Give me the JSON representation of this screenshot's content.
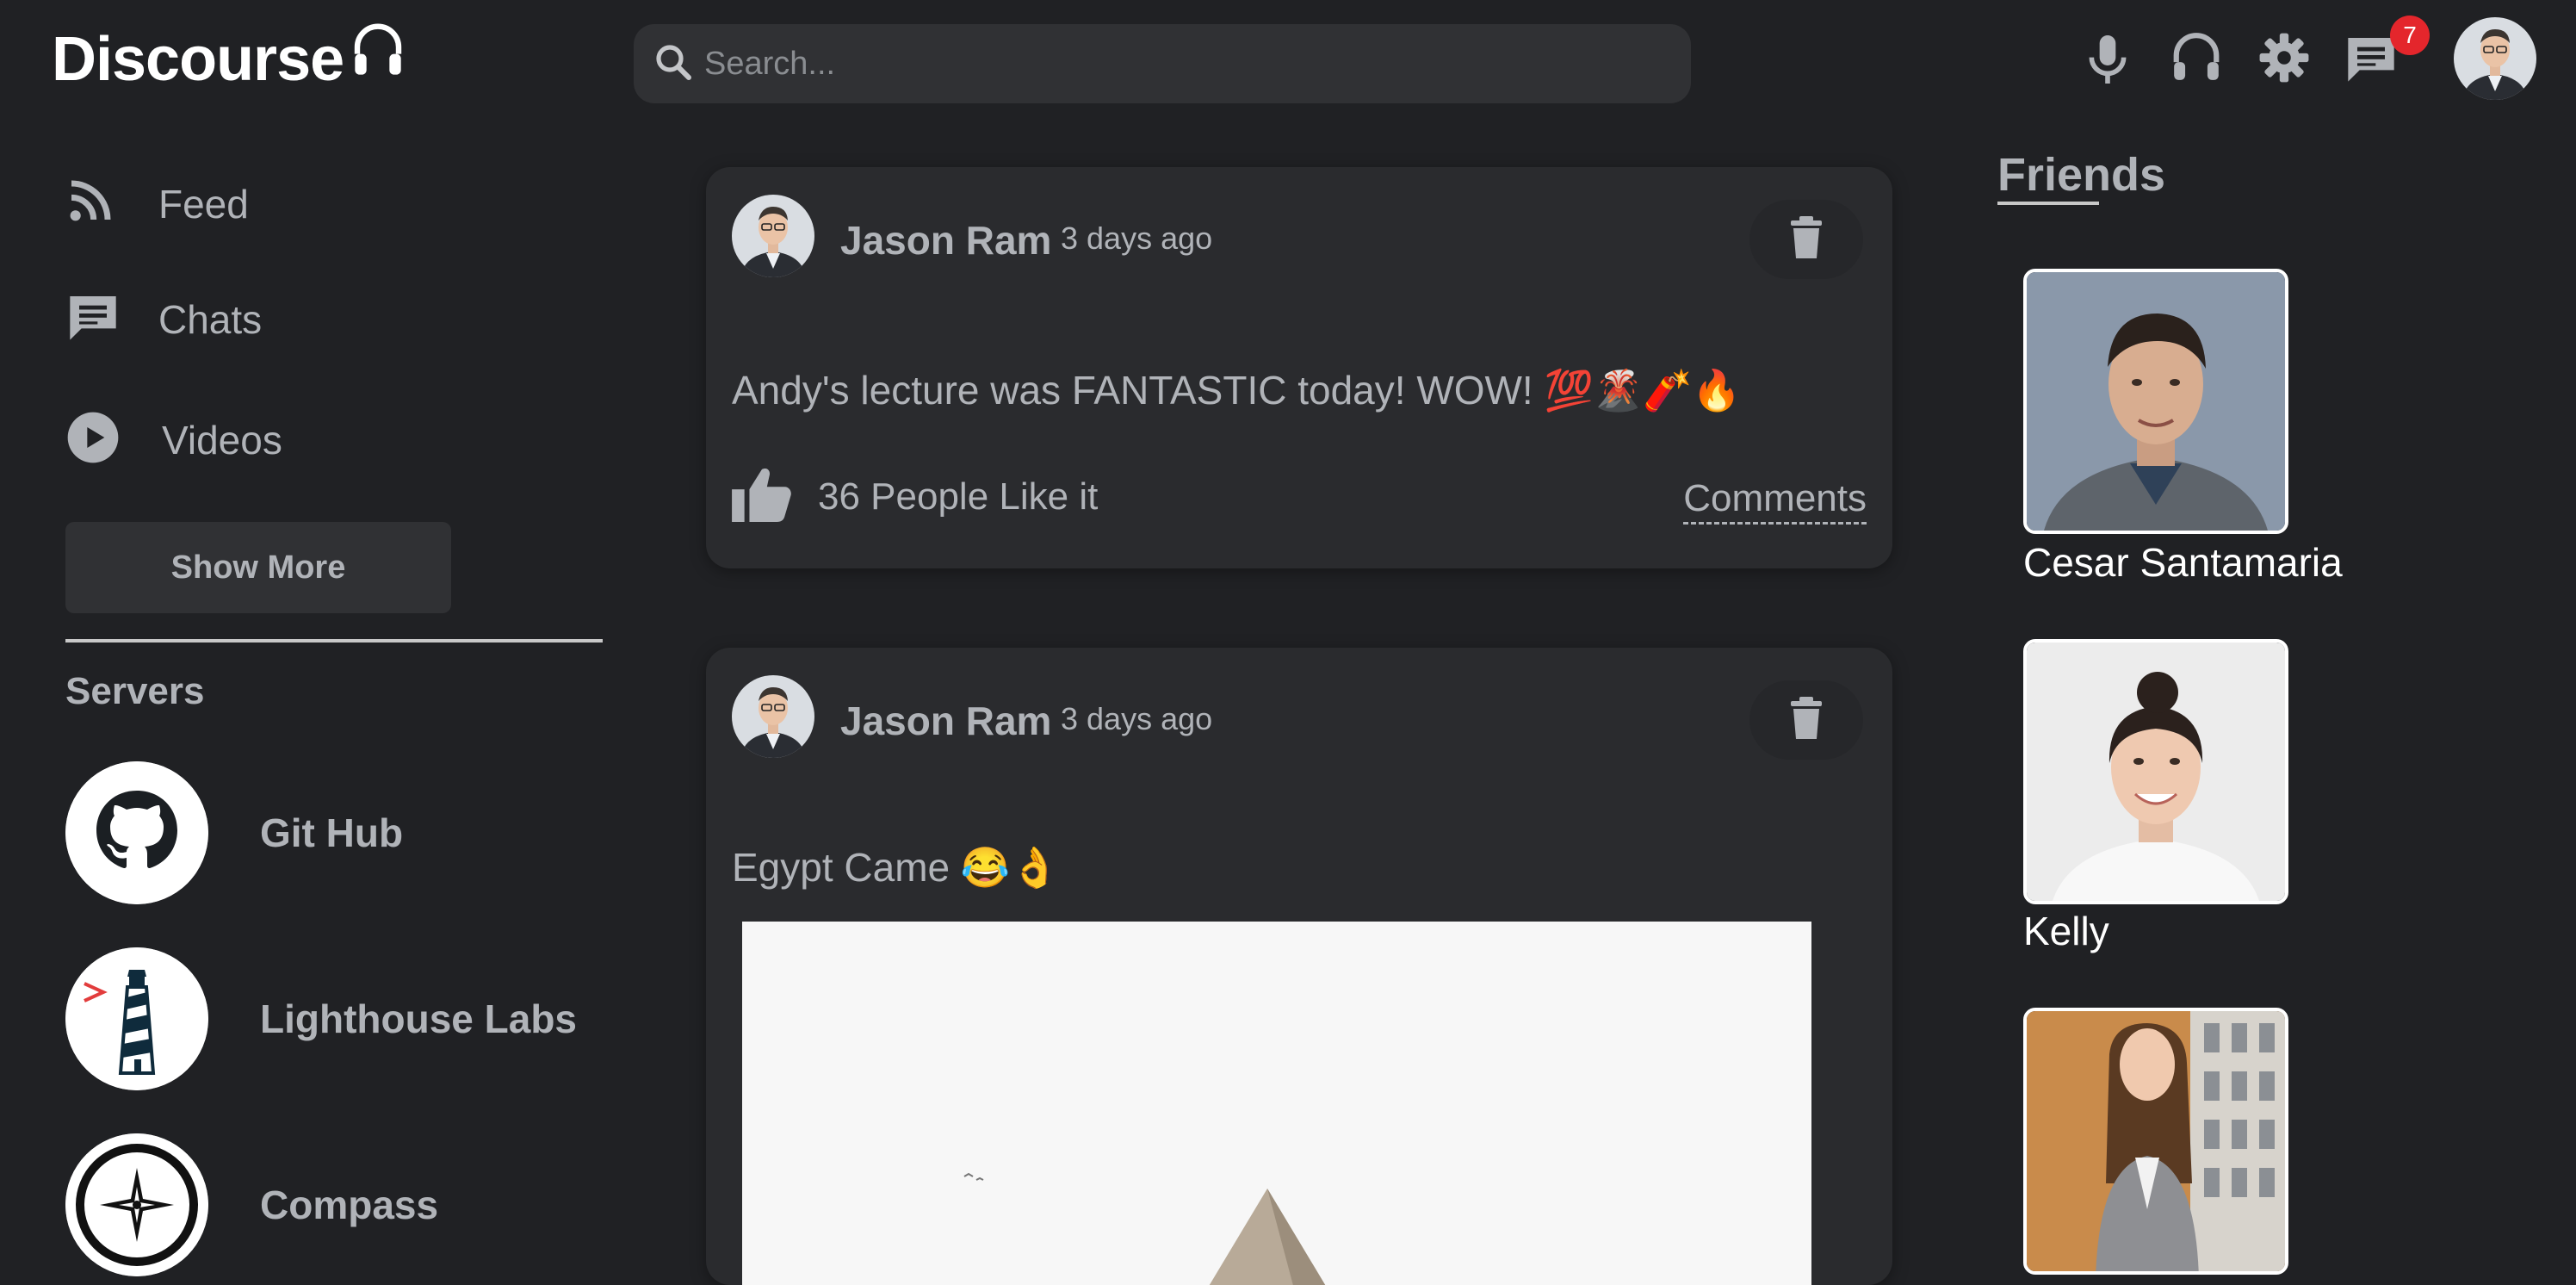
{
  "app": {
    "logo_text": "Discourse",
    "logo_icon": "headphones-icon"
  },
  "search": {
    "placeholder": "Search..."
  },
  "topbar": {
    "icons": [
      "microphone-icon",
      "headphones-icon",
      "gear-icon",
      "chat-icon"
    ],
    "notification_count": "7"
  },
  "sidebar": {
    "nav": [
      {
        "label": "Feed",
        "icon": "rss-icon"
      },
      {
        "label": "Chats",
        "icon": "chat-icon"
      },
      {
        "label": "Videos",
        "icon": "play-icon"
      }
    ],
    "show_more_label": "Show More",
    "servers_title": "Servers",
    "servers": [
      {
        "name": "Git Hub",
        "logo": "github-icon"
      },
      {
        "name": "Lighthouse Labs",
        "logo": "lighthouse-icon"
      },
      {
        "name": "Compass",
        "logo": "compass-icon"
      }
    ]
  },
  "feed": {
    "posts": [
      {
        "author": "Jason Ram",
        "time": "3 days ago",
        "text": "Andy's lecture was FANTASTIC today! WOW! 💯🌋🧨🔥",
        "likes": "36 People Like it",
        "comments_label": "Comments"
      },
      {
        "author": "Jason Ram",
        "time": "3 days ago",
        "text": "Egypt Came 😂👌"
      }
    ]
  },
  "friends": {
    "title": "Friends",
    "list": [
      {
        "name": "Cesar Santamaria"
      },
      {
        "name": "Kelly"
      },
      {
        "name": ""
      }
    ]
  },
  "colors": {
    "background": "#202124",
    "card": "#2a2b2e",
    "text": "#b0b3b8",
    "badge": "#e4262c",
    "white": "#ffffff"
  }
}
